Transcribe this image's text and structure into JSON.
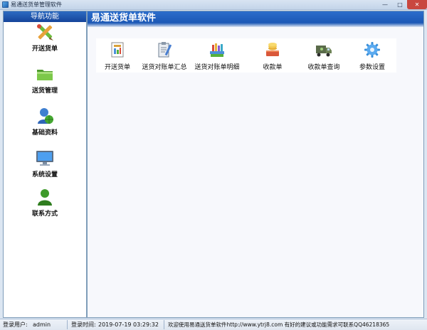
{
  "window": {
    "title": "易通送货单管理软件",
    "minimize": "—",
    "maximize": "□",
    "close": "✕"
  },
  "nav": {
    "header": "导航功能",
    "items": [
      {
        "label": "开送货单",
        "icon": "pencil-ruler-icon"
      },
      {
        "label": "送货管理",
        "icon": "folder-icon"
      },
      {
        "label": "基础资料",
        "icon": "user-globe-icon"
      },
      {
        "label": "系统设置",
        "icon": "monitor-icon"
      },
      {
        "label": "联系方式",
        "icon": "person-icon"
      }
    ]
  },
  "main": {
    "title": "易通送货单软件",
    "toolbar": [
      {
        "label": "开送货单",
        "icon": "invoice-icon"
      },
      {
        "label": "送货对账单汇总",
        "icon": "clipboard-pencil-icon"
      },
      {
        "label": "送货对账单明细",
        "icon": "books-icon"
      },
      {
        "label": "收款单",
        "icon": "coins-icon"
      },
      {
        "label": "收款单查询",
        "icon": "delivery-truck-icon"
      },
      {
        "label": "参数设置",
        "icon": "gear-icon"
      }
    ]
  },
  "status": {
    "user_label": "登录用户:",
    "user_value": "admin",
    "time_label": "登录时间:",
    "time_value": "2019-07-19  03:29:32",
    "message": "欢迎使用易通送货单软件http://www.ytrj8.com 有好的建议或功能需求可联系QQ46218365"
  },
  "colors": {
    "banner": "#1f5fbf",
    "nav_header": "#15449a",
    "close": "#c9473f"
  }
}
